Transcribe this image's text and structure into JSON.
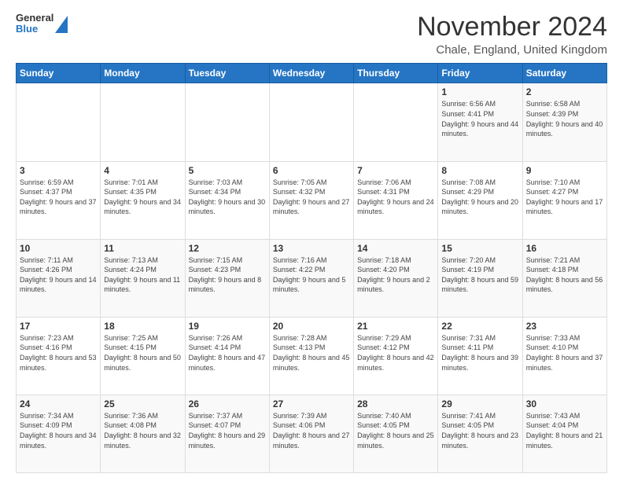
{
  "logo": {
    "general": "General",
    "blue": "Blue"
  },
  "header": {
    "month": "November 2024",
    "location": "Chale, England, United Kingdom"
  },
  "weekdays": [
    "Sunday",
    "Monday",
    "Tuesday",
    "Wednesday",
    "Thursday",
    "Friday",
    "Saturday"
  ],
  "weeks": [
    [
      {
        "day": "",
        "info": ""
      },
      {
        "day": "",
        "info": ""
      },
      {
        "day": "",
        "info": ""
      },
      {
        "day": "",
        "info": ""
      },
      {
        "day": "",
        "info": ""
      },
      {
        "day": "1",
        "info": "Sunrise: 6:56 AM\nSunset: 4:41 PM\nDaylight: 9 hours and 44 minutes."
      },
      {
        "day": "2",
        "info": "Sunrise: 6:58 AM\nSunset: 4:39 PM\nDaylight: 9 hours and 40 minutes."
      }
    ],
    [
      {
        "day": "3",
        "info": "Sunrise: 6:59 AM\nSunset: 4:37 PM\nDaylight: 9 hours and 37 minutes."
      },
      {
        "day": "4",
        "info": "Sunrise: 7:01 AM\nSunset: 4:35 PM\nDaylight: 9 hours and 34 minutes."
      },
      {
        "day": "5",
        "info": "Sunrise: 7:03 AM\nSunset: 4:34 PM\nDaylight: 9 hours and 30 minutes."
      },
      {
        "day": "6",
        "info": "Sunrise: 7:05 AM\nSunset: 4:32 PM\nDaylight: 9 hours and 27 minutes."
      },
      {
        "day": "7",
        "info": "Sunrise: 7:06 AM\nSunset: 4:31 PM\nDaylight: 9 hours and 24 minutes."
      },
      {
        "day": "8",
        "info": "Sunrise: 7:08 AM\nSunset: 4:29 PM\nDaylight: 9 hours and 20 minutes."
      },
      {
        "day": "9",
        "info": "Sunrise: 7:10 AM\nSunset: 4:27 PM\nDaylight: 9 hours and 17 minutes."
      }
    ],
    [
      {
        "day": "10",
        "info": "Sunrise: 7:11 AM\nSunset: 4:26 PM\nDaylight: 9 hours and 14 minutes."
      },
      {
        "day": "11",
        "info": "Sunrise: 7:13 AM\nSunset: 4:24 PM\nDaylight: 9 hours and 11 minutes."
      },
      {
        "day": "12",
        "info": "Sunrise: 7:15 AM\nSunset: 4:23 PM\nDaylight: 9 hours and 8 minutes."
      },
      {
        "day": "13",
        "info": "Sunrise: 7:16 AM\nSunset: 4:22 PM\nDaylight: 9 hours and 5 minutes."
      },
      {
        "day": "14",
        "info": "Sunrise: 7:18 AM\nSunset: 4:20 PM\nDaylight: 9 hours and 2 minutes."
      },
      {
        "day": "15",
        "info": "Sunrise: 7:20 AM\nSunset: 4:19 PM\nDaylight: 8 hours and 59 minutes."
      },
      {
        "day": "16",
        "info": "Sunrise: 7:21 AM\nSunset: 4:18 PM\nDaylight: 8 hours and 56 minutes."
      }
    ],
    [
      {
        "day": "17",
        "info": "Sunrise: 7:23 AM\nSunset: 4:16 PM\nDaylight: 8 hours and 53 minutes."
      },
      {
        "day": "18",
        "info": "Sunrise: 7:25 AM\nSunset: 4:15 PM\nDaylight: 8 hours and 50 minutes."
      },
      {
        "day": "19",
        "info": "Sunrise: 7:26 AM\nSunset: 4:14 PM\nDaylight: 8 hours and 47 minutes."
      },
      {
        "day": "20",
        "info": "Sunrise: 7:28 AM\nSunset: 4:13 PM\nDaylight: 8 hours and 45 minutes."
      },
      {
        "day": "21",
        "info": "Sunrise: 7:29 AM\nSunset: 4:12 PM\nDaylight: 8 hours and 42 minutes."
      },
      {
        "day": "22",
        "info": "Sunrise: 7:31 AM\nSunset: 4:11 PM\nDaylight: 8 hours and 39 minutes."
      },
      {
        "day": "23",
        "info": "Sunrise: 7:33 AM\nSunset: 4:10 PM\nDaylight: 8 hours and 37 minutes."
      }
    ],
    [
      {
        "day": "24",
        "info": "Sunrise: 7:34 AM\nSunset: 4:09 PM\nDaylight: 8 hours and 34 minutes."
      },
      {
        "day": "25",
        "info": "Sunrise: 7:36 AM\nSunset: 4:08 PM\nDaylight: 8 hours and 32 minutes."
      },
      {
        "day": "26",
        "info": "Sunrise: 7:37 AM\nSunset: 4:07 PM\nDaylight: 8 hours and 29 minutes."
      },
      {
        "day": "27",
        "info": "Sunrise: 7:39 AM\nSunset: 4:06 PM\nDaylight: 8 hours and 27 minutes."
      },
      {
        "day": "28",
        "info": "Sunrise: 7:40 AM\nSunset: 4:05 PM\nDaylight: 8 hours and 25 minutes."
      },
      {
        "day": "29",
        "info": "Sunrise: 7:41 AM\nSunset: 4:05 PM\nDaylight: 8 hours and 23 minutes."
      },
      {
        "day": "30",
        "info": "Sunrise: 7:43 AM\nSunset: 4:04 PM\nDaylight: 8 hours and 21 minutes."
      }
    ]
  ]
}
